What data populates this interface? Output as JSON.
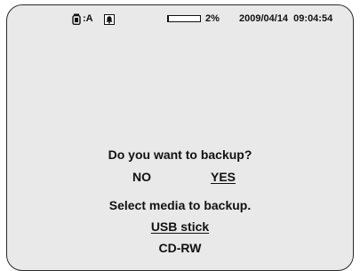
{
  "status_bar": {
    "camera_icon": "camera-icon",
    "camera_label": ":A",
    "alarm_icon": "bell-alarm-icon",
    "disk_usage_fraction": 0.02,
    "disk_usage_text": "2%",
    "datetime": "2009/04/14  09:04:54"
  },
  "dialog": {
    "backup_question": "Do you want to backup?",
    "no_label": "NO",
    "yes_label": "YES",
    "selected_answer": "YES",
    "media_prompt": "Select media to backup.",
    "media_options": [
      "USB stick",
      "CD-RW"
    ],
    "selected_media": "USB stick"
  }
}
